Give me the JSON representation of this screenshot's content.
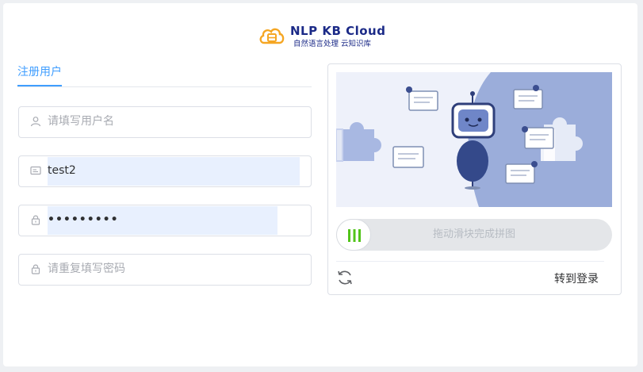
{
  "brand": {
    "title": "NLP KB Cloud",
    "subtitle": "自然语言处理 云知识库",
    "logo_icon": "cloud-database-icon",
    "accent": "#1b2a87",
    "logo_color": "#f5a623"
  },
  "tabs": [
    {
      "label": "注册用户",
      "active": true
    }
  ],
  "form": {
    "username": {
      "value": "",
      "placeholder": "请填写用户名",
      "icon": "user-icon"
    },
    "nickname": {
      "value": "test2",
      "placeholder": "",
      "icon": "id-card-icon"
    },
    "password": {
      "value": "•••••••••",
      "placeholder": "",
      "icon": "lock-icon"
    },
    "confirm_password": {
      "value": "",
      "placeholder": "请重复填写密码",
      "icon": "lock-icon"
    }
  },
  "captcha": {
    "slider_text": "拖动滑块完成拼图",
    "refresh_icon": "refresh-icon",
    "go_login": "转到登录",
    "slider_progress": 0
  },
  "colors": {
    "primary": "#409eff",
    "autofill": "#e8f0fe",
    "slider_bars": "#52c41a"
  }
}
